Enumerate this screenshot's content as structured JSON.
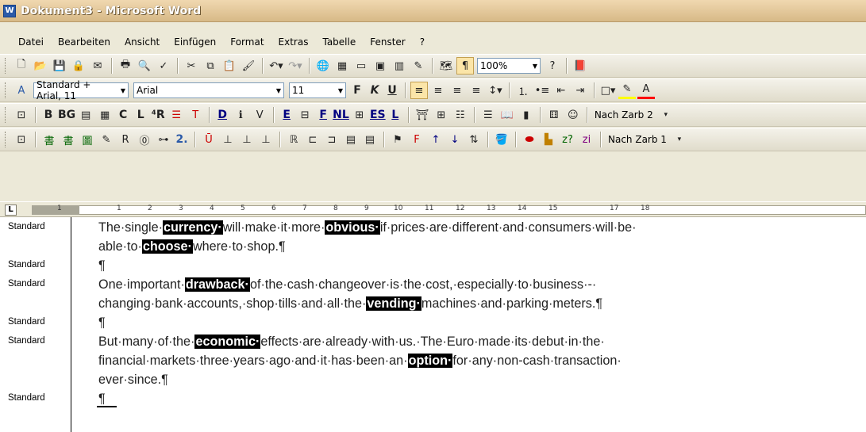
{
  "window": {
    "title": "Dokument3 - Microsoft Word",
    "app_icon": "word-icon"
  },
  "menu": [
    "Datei",
    "Bearbeiten",
    "Ansicht",
    "Einfügen",
    "Format",
    "Extras",
    "Tabelle",
    "Fenster",
    "?"
  ],
  "standard_toolbar": {
    "zoom": "100%"
  },
  "format_toolbar": {
    "style": "Standard + Arial, 11",
    "font": "Arial",
    "size": "11"
  },
  "custom_toolbar_1": {
    "label": "Nach Zarb 2"
  },
  "custom_toolbar_2": {
    "label": "Nach Zarb 1"
  },
  "ruler": {
    "numbers": [
      "1",
      "1",
      "2",
      "3",
      "4",
      "5",
      "6",
      "7",
      "8",
      "9",
      "10",
      "11",
      "12",
      "13",
      "14",
      "15",
      "17",
      "18"
    ]
  },
  "document": {
    "style_name": "Standard",
    "paragraphs": [
      {
        "lines": [
          [
            {
              "t": "The·single·"
            },
            {
              "t": "currency·",
              "hl": true
            },
            {
              "t": "will·make·it·more·"
            },
            {
              "t": "obvious·",
              "hl": true
            },
            {
              "t": "if·prices·are·different·and·consumers·will·be·"
            }
          ],
          [
            {
              "t": "able·to·"
            },
            {
              "t": "choose·",
              "hl": true
            },
            {
              "t": "where·to·shop.¶"
            }
          ]
        ]
      },
      {
        "lines": [
          [
            {
              "t": "¶"
            }
          ]
        ]
      },
      {
        "lines": [
          [
            {
              "t": "One·important·"
            },
            {
              "t": "drawback·",
              "hl": true
            },
            {
              "t": "of·the·cash·changeover·is·the·cost,·especially·to·business·-·"
            }
          ],
          [
            {
              "t": "changing·bank·accounts,·shop·tills·and·all·the·"
            },
            {
              "t": "vending·",
              "hl": true
            },
            {
              "t": "machines·and·parking·meters.¶"
            }
          ]
        ]
      },
      {
        "lines": [
          [
            {
              "t": "¶"
            }
          ]
        ]
      },
      {
        "lines": [
          [
            {
              "t": "But·many·of·the·"
            },
            {
              "t": "economic·",
              "hl": true
            },
            {
              "t": "effects·are·already·with·us.·The·Euro·made·its·debut·in·the·"
            }
          ],
          [
            {
              "t": "financial·markets·three·years·ago·and·it·has·been·an·"
            },
            {
              "t": "option·",
              "hl": true
            },
            {
              "t": "for·any·non-cash·transaction·"
            }
          ],
          [
            {
              "t": "ever·since.¶"
            }
          ]
        ]
      },
      {
        "lines": [
          [
            {
              "t": "¶"
            }
          ]
        ]
      }
    ]
  }
}
